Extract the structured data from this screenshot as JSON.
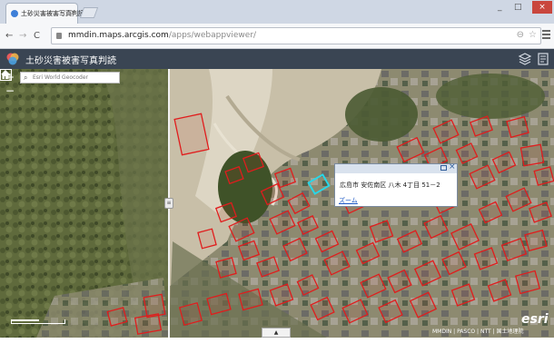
{
  "browser": {
    "tab_title": "土砂災害被害写真判読",
    "url_host": "mmdin.maps.arcgis.com",
    "url_path": "/apps/webappviewer/",
    "back": "←",
    "forward": "→",
    "reload": "C",
    "zoom_glyph": "⊖",
    "star_glyph": "☆",
    "minimize": "_",
    "maximize": "□",
    "close": "×"
  },
  "app": {
    "title": "土砂災害被害写真判読"
  },
  "map": {
    "zoom_in": "+",
    "zoom_out": "−",
    "search_placeholder": "Esri World Geocoder",
    "search_icon": "⌕",
    "swipe_handle": "≡",
    "popup": {
      "address": "広島市 安佐南区 八木 4丁目 51－2",
      "zoom_link": "ズーム"
    },
    "bottom_tab": "▲",
    "attribution": "MMDIN | PASCO | NTT | 国土地理院",
    "esri": "esri"
  },
  "colors": {
    "header": "#3a4553",
    "parcel_outline": "#e01d1d",
    "selected_parcel": "#28d7e8"
  }
}
